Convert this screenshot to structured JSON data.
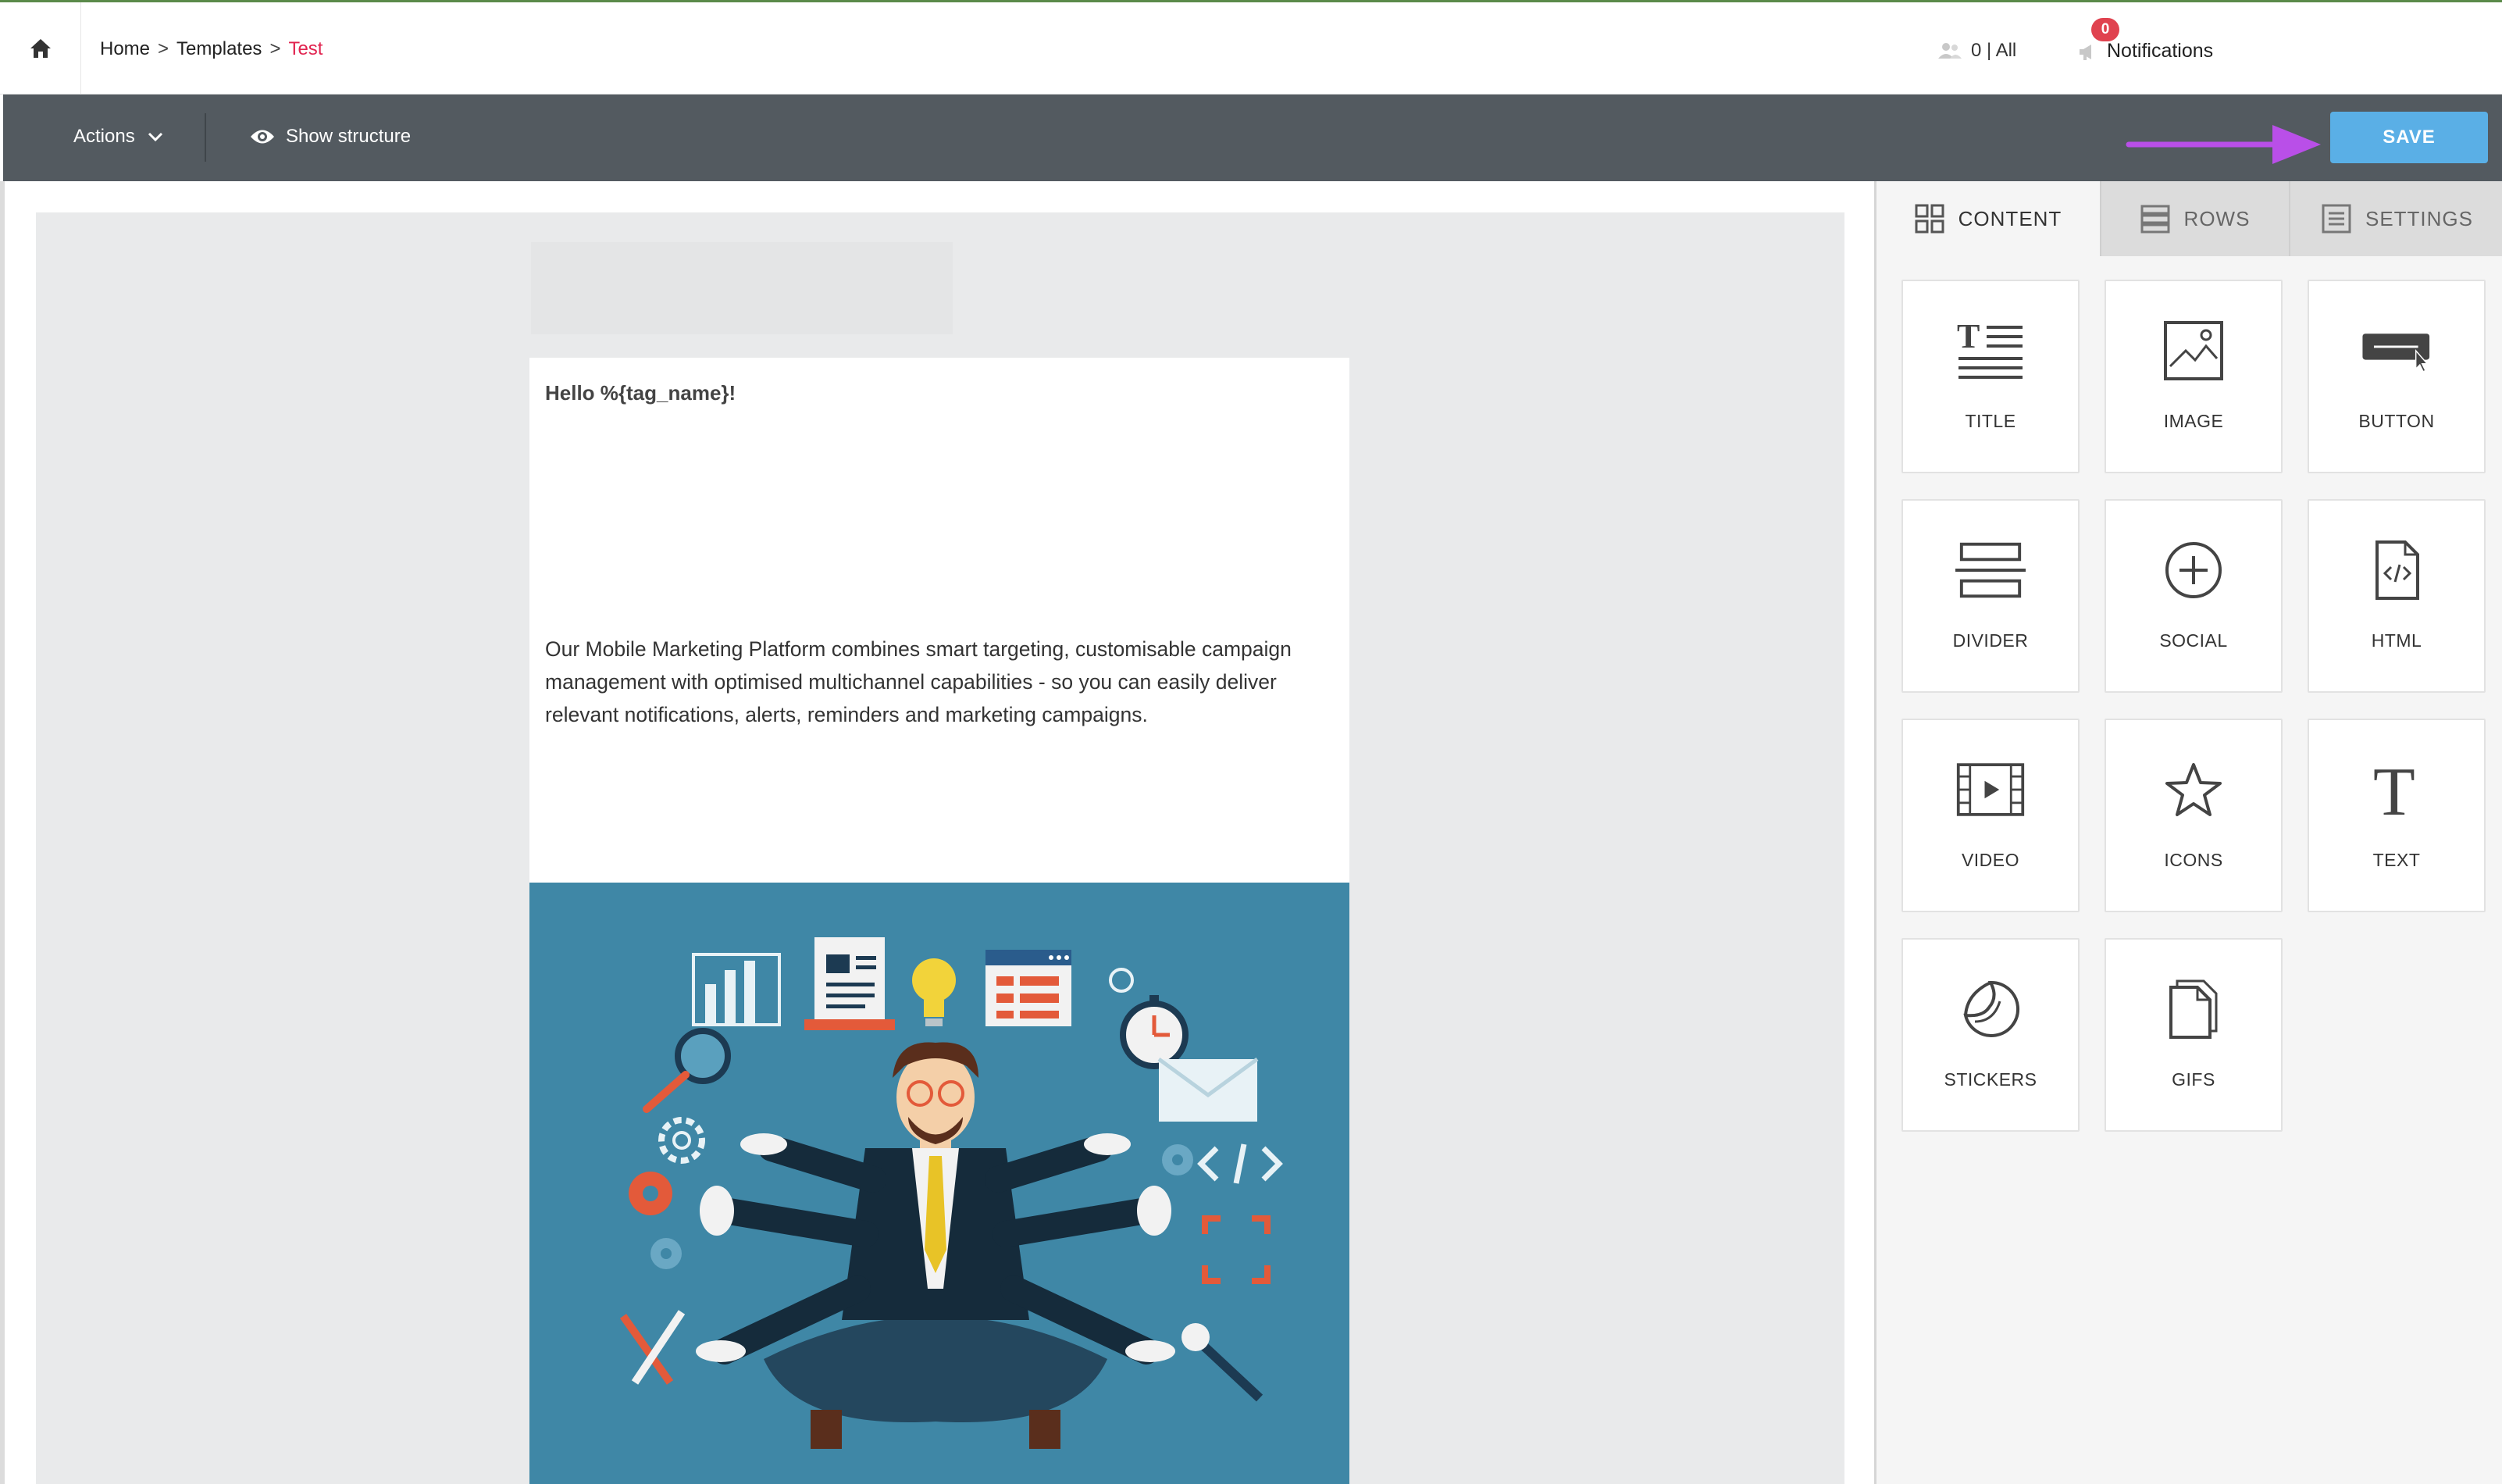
{
  "breadcrumb": {
    "home": "Home",
    "sep1": ">",
    "templates": "Templates",
    "sep2": ">",
    "current": "Test"
  },
  "header": {
    "users": "0 | All",
    "notifications_label": "Notifications",
    "notifications_count": "0"
  },
  "toolbar": {
    "actions": "Actions",
    "show_structure": "Show structure",
    "save": "SAVE"
  },
  "email": {
    "greeting": "Hello %{tag_name}!",
    "body": "Our Mobile Marketing Platform combines smart targeting, customisable campaign management with optimised multichannel capabilities - so you can easily deliver relevant notifications, alerts, reminders and marketing campaigns."
  },
  "panel": {
    "tabs": [
      {
        "label": "CONTENT",
        "icon": "grid-icon"
      },
      {
        "label": "ROWS",
        "icon": "rows-icon"
      },
      {
        "label": "SETTINGS",
        "icon": "settings-list-icon"
      }
    ],
    "blocks": [
      {
        "label": "TITLE",
        "icon": "title-icon"
      },
      {
        "label": "IMAGE",
        "icon": "image-icon"
      },
      {
        "label": "BUTTON",
        "icon": "button-icon"
      },
      {
        "label": "DIVIDER",
        "icon": "divider-icon"
      },
      {
        "label": "SOCIAL",
        "icon": "social-plus-icon"
      },
      {
        "label": "HTML",
        "icon": "html-file-icon"
      },
      {
        "label": "VIDEO",
        "icon": "video-icon"
      },
      {
        "label": "ICONS",
        "icon": "star-icon"
      },
      {
        "label": "TEXT",
        "icon": "text-t-icon"
      },
      {
        "label": "STICKERS",
        "icon": "sticker-icon"
      },
      {
        "label": "GIFS",
        "icon": "gif-file-icon"
      }
    ]
  },
  "colors": {
    "accent": "#5aafe6",
    "toolbar": "#535a60",
    "breadcrumb_current": "#e1234f",
    "arrow": "#b94fe8",
    "image_bg": "#3f87a6"
  }
}
